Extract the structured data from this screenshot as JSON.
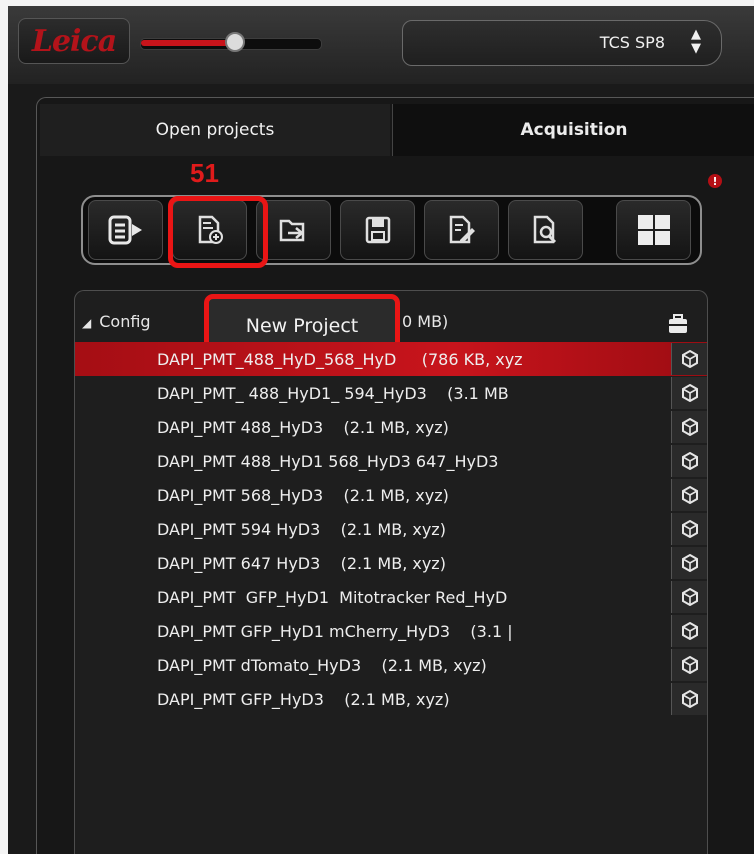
{
  "header": {
    "logo_text": "Leica",
    "slider_level_percent": 52,
    "machine_select_value": "TCS SP8",
    "machine_select_arrows": "⬍"
  },
  "tabs": [
    {
      "label": "Open projects",
      "active": true
    },
    {
      "label": "Acquisition",
      "active": false
    }
  ],
  "annotation": {
    "step_number": "51",
    "color": "#ea1515"
  },
  "info_badge": "!",
  "toolbar": {
    "buttons": [
      {
        "icon": "export-list-icon"
      },
      {
        "icon": "new-project-icon",
        "highlighted": true
      },
      {
        "icon": "open-project-icon"
      },
      {
        "icon": "save-icon"
      },
      {
        "icon": "save-as-icon"
      },
      {
        "icon": "find-icon"
      },
      {
        "icon": "layout-grid-icon"
      }
    ]
  },
  "tooltip": {
    "text": "New Project"
  },
  "tree": {
    "root_label": "Config",
    "root_size": "0 MB)",
    "items": [
      {
        "label": "DAPI_PMT_488_HyD_568_HyD     (786 KB, xyz",
        "selected": true
      },
      {
        "label": "DAPI_PMT_ 488_HyD1_ 594_HyD3    (3.1 MB",
        "selected": false
      },
      {
        "label": "DAPI_PMT 488_HyD3    (2.1 MB, xyz)",
        "selected": false
      },
      {
        "label": "DAPI_PMT 488_HyD1 568_HyD3 647_HyD3",
        "selected": false
      },
      {
        "label": "DAPI_PMT 568_HyD3    (2.1 MB, xyz)",
        "selected": false
      },
      {
        "label": "DAPI_PMT 594 HyD3    (2.1 MB, xyz)",
        "selected": false
      },
      {
        "label": "DAPI_PMT 647 HyD3    (2.1 MB, xyz)",
        "selected": false
      },
      {
        "label": "DAPI_PMT  GFP_HyD1  Mitotracker Red_HyD",
        "selected": false
      },
      {
        "label": "DAPI_PMT GFP_HyD1 mCherry_HyD3    (3.1 |",
        "selected": false
      },
      {
        "label": "DAPI_PMT dTomato_HyD3    (2.1 MB, xyz)",
        "selected": false
      },
      {
        "label": "DAPI_PMT GFP_HyD3    (2.1 MB, xyz)",
        "selected": false
      }
    ]
  },
  "colors": {
    "brand_red": "#c8141b",
    "selection": "#b51118",
    "background": "#1a1a1a"
  }
}
